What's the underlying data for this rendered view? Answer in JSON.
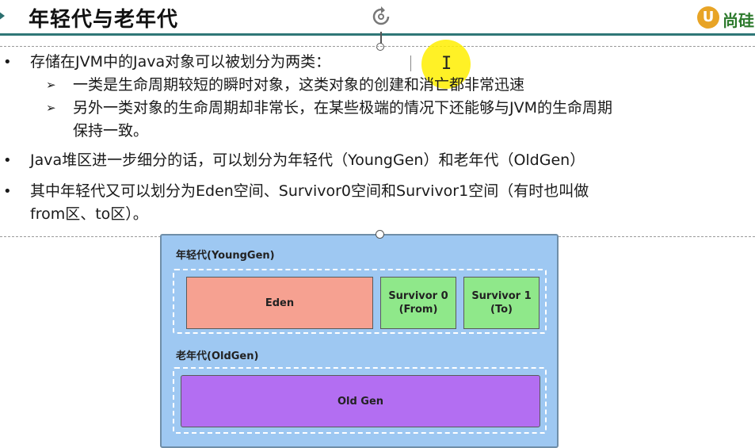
{
  "slide": {
    "title": "年轻代与老年代",
    "logo_text": "尚硅",
    "logo_letter": "U"
  },
  "bullets": [
    {
      "text": "存储在JVM中的Java对象可以被划分为两类：",
      "sub": [
        {
          "lines": [
            "一类是生命周期较短的瞬时对象，这类对象的创建和消亡都非常迅速"
          ]
        },
        {
          "lines": [
            "另外一类对象的生命周期却非常长，在某些极端的情况下还能够与JVM的生命周期",
            "保持一致。"
          ]
        }
      ]
    },
    {
      "lines": [
        "Java堆区进一步细分的话，可以划分为年轻代（YoungGen）和老年代（OldGen）"
      ]
    },
    {
      "lines": [
        "其中年轻代又可以划分为Eden空间、Survivor0空间和Survivor1空间（有时也叫做",
        "from区、to区）。"
      ]
    }
  ],
  "diagram": {
    "young_label": "年轻代(YoungGen)",
    "eden": "Eden",
    "survivor0": "Survivor 0\n(From)",
    "survivor1": "Survivor 1\n(To)",
    "old_label": "老年代(OldGen)",
    "old_gen": "Old Gen"
  },
  "colors": {
    "header_rule": "#2f7777",
    "diagram_bg": "#9ec8f2",
    "eden": "#f6a191",
    "survivor": "#8fe88a",
    "old_gen": "#b36ef2",
    "cursor_highlight": "#ffee00"
  },
  "icons": {
    "anchor": "rotate-anchor-icon",
    "cursor": "text-cursor-icon",
    "bullet": "bullet-dot-icon",
    "sub_bullet": "arrow-bullet-icon"
  }
}
